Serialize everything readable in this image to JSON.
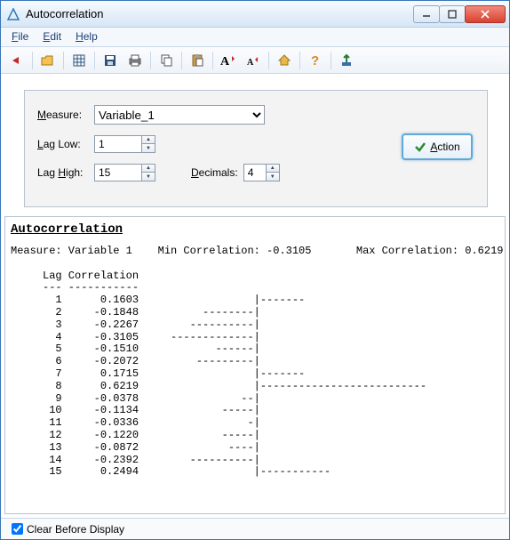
{
  "titlebar": {
    "title": "Autocorrelation"
  },
  "menubar": {
    "file": "File",
    "edit": "Edit",
    "help": "Help"
  },
  "form": {
    "measure_label": "Measure:",
    "measure_value": "Variable_1",
    "laglow_label": "Lag Low:",
    "laglow_value": "1",
    "laghigh_label": "Lag High:",
    "laghigh_value": "15",
    "decimals_label": "Decimals:",
    "decimals_value": "4",
    "action_label": "Action"
  },
  "output": {
    "title": "Autocorrelation",
    "summary_measure_label": "Measure:",
    "summary_measure": "Variable 1",
    "summary_min_label": "Min Correlation:",
    "summary_min": "-0.3105",
    "summary_max_label": "Max Correlation:",
    "summary_max": "0.6219",
    "col_lag": "Lag",
    "col_corr": "Correlation",
    "rows": [
      {
        "lag": 1,
        "corr": "0.1603",
        "bar": "|-------"
      },
      {
        "lag": 2,
        "corr": "-0.1848",
        "bar": "--------|"
      },
      {
        "lag": 3,
        "corr": "-0.2267",
        "bar": "----------|"
      },
      {
        "lag": 4,
        "corr": "-0.3105",
        "bar": "-------------|"
      },
      {
        "lag": 5,
        "corr": "-0.1510",
        "bar": "------|"
      },
      {
        "lag": 6,
        "corr": "-0.2072",
        "bar": "---------|"
      },
      {
        "lag": 7,
        "corr": "0.1715",
        "bar": "|-------"
      },
      {
        "lag": 8,
        "corr": "0.6219",
        "bar": "|--------------------------"
      },
      {
        "lag": 9,
        "corr": "-0.0378",
        "bar": "--|"
      },
      {
        "lag": 10,
        "corr": "-0.1134",
        "bar": "-----|"
      },
      {
        "lag": 11,
        "corr": "-0.0336",
        "bar": "-|"
      },
      {
        "lag": 12,
        "corr": "-0.1220",
        "bar": "-----|"
      },
      {
        "lag": 13,
        "corr": "-0.0872",
        "bar": "----|"
      },
      {
        "lag": 14,
        "corr": "-0.2392",
        "bar": "----------|"
      },
      {
        "lag": 15,
        "corr": "0.2494",
        "bar": "|-----------"
      }
    ]
  },
  "footer": {
    "clear_label": "Clear Before Display",
    "clear_checked": true
  },
  "chart_data": {
    "type": "bar",
    "title": "Autocorrelation",
    "xlabel": "Lag",
    "ylabel": "Correlation",
    "categories": [
      1,
      2,
      3,
      4,
      5,
      6,
      7,
      8,
      9,
      10,
      11,
      12,
      13,
      14,
      15
    ],
    "values": [
      0.1603,
      -0.1848,
      -0.2267,
      -0.3105,
      -0.151,
      -0.2072,
      0.1715,
      0.6219,
      -0.0378,
      -0.1134,
      -0.0336,
      -0.122,
      -0.0872,
      -0.2392,
      0.2494
    ],
    "ylim": [
      -0.35,
      0.65
    ]
  }
}
